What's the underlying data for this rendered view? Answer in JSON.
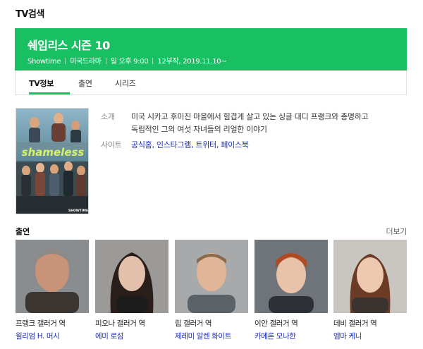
{
  "section_title": "TV검색",
  "show": {
    "title": "쉐임리스 시즌 10",
    "meta": [
      "Showtime",
      "미국드라마",
      "일 오후 9:00",
      "12부작, 2019.11.10~"
    ]
  },
  "tabs": [
    {
      "label": "TV정보",
      "active": true
    },
    {
      "label": "출연",
      "active": false
    },
    {
      "label": "시리즈",
      "active": false
    }
  ],
  "poster": {
    "logo_text": "shameless",
    "badge_text": "SHOWTIME"
  },
  "info": {
    "summary_label": "소개",
    "summary_lines": [
      "미국 시카고 후미진 마을에서 힘겹게 살고 있는 싱글 대디 프랭크와 총명하고",
      "독립적인 그의 여섯 자녀들의 리얼한 이야기"
    ],
    "site_label": "사이트",
    "site_links": [
      "공식홈",
      "인스타그램",
      "트위터",
      "페이스북"
    ]
  },
  "cast": {
    "title": "출연",
    "more_label": "더보기",
    "members": [
      {
        "role": "프랭크 갤러거 역",
        "actor": "윌리엄 H. 머시"
      },
      {
        "role": "피오나 갤러거 역",
        "actor": "에미 로섬"
      },
      {
        "role": "립 갤러거 역",
        "actor": "제레미 알렌 화이트"
      },
      {
        "role": "이안 갤러거 역",
        "actor": "카메론 모나한"
      },
      {
        "role": "데비 갤러거 역",
        "actor": "엠마 케니"
      }
    ]
  },
  "colors": {
    "accent": "#19c063",
    "link": "#1a2dbb"
  }
}
